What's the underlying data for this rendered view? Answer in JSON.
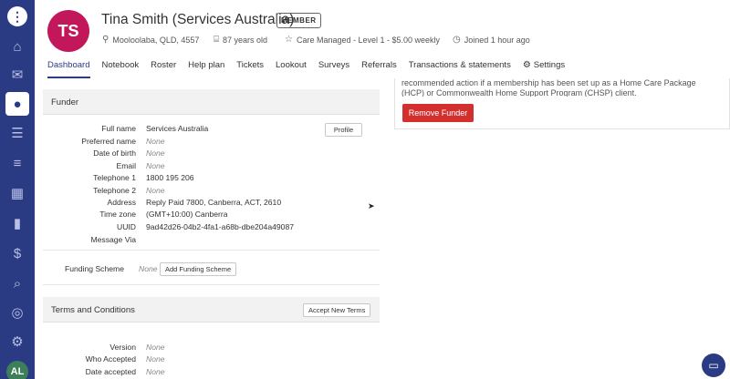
{
  "rail": {
    "logo": "⋮",
    "icons": [
      "home-icon",
      "inbox-icon",
      "person-icon",
      "stack-icon",
      "timeline-icon",
      "calendar-icon",
      "chart-icon",
      "dollar-icon",
      "search-icon",
      "support-icon",
      "settings-icon"
    ],
    "avatar_initials": "AL"
  },
  "client": {
    "initials": "TS",
    "name": "Tina Smith (Services Australia)",
    "badge": "MEMBER",
    "location": "Mooloolaba, QLD, 4557",
    "age": "87 years old",
    "care_level": "Care Managed - Level 1 - $5.00 weekly",
    "joined": "Joined 1 hour ago"
  },
  "tabs": [
    "Dashboard",
    "Notebook",
    "Roster",
    "Help plan",
    "Tickets",
    "Lookout",
    "Surveys",
    "Referrals",
    "Transactions & statements",
    "Settings"
  ],
  "funder": {
    "title": "Funder",
    "profile_button": "Profile",
    "rows": [
      {
        "label": "Full name",
        "value": "Services Australia"
      },
      {
        "label": "Preferred name",
        "value": "None"
      },
      {
        "label": "Date of birth",
        "value": "None"
      },
      {
        "label": "Email",
        "value": "None"
      },
      {
        "label": "Telephone 1",
        "value": "1800 195 206"
      },
      {
        "label": "Telephone 2",
        "value": "None"
      },
      {
        "label": "Address",
        "value": "Reply Paid 7800, Canberra, ACT, 2610"
      },
      {
        "label": "Time zone",
        "value": "(GMT+10:00) Canberra"
      },
      {
        "label": "UUID",
        "value": "9ad42d26-04b2-4fa1-a68b-dbe204a49087"
      },
      {
        "label": "Message Via",
        "value": ""
      }
    ],
    "funding_scheme_label": "Funding Scheme",
    "funding_scheme_value": "None",
    "add_funding_scheme": "Add Funding Scheme"
  },
  "terms": {
    "title": "Terms and Conditions",
    "accept_button": "Accept New Terms",
    "rows": [
      {
        "label": "Version",
        "value": "None"
      },
      {
        "label": "Who Accepted",
        "value": "None"
      },
      {
        "label": "Date accepted",
        "value": "None"
      }
    ]
  },
  "right_panel": {
    "text": "recommended action if a membership has been set up as a Home Care Package (HCP) or Commonwealth Home Support Program (CHSP) client.",
    "remove_button": "Remove Funder"
  },
  "colors": {
    "primary": "#2a3a83",
    "avatar": "#c2185b",
    "danger": "#d32f2f"
  }
}
